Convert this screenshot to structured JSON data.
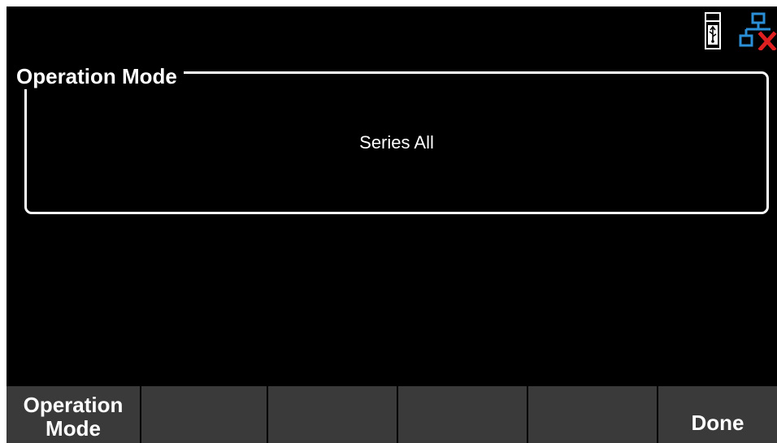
{
  "status_icons": {
    "usb": "usb-icon",
    "network": "network-disconnected-icon"
  },
  "operation_mode": {
    "title": "Operation Mode",
    "value": "Series All"
  },
  "softkeys": [
    {
      "label": "Operation\nMode"
    },
    {
      "label": ""
    },
    {
      "label": ""
    },
    {
      "label": ""
    },
    {
      "label": ""
    },
    {
      "label": "Done"
    }
  ],
  "colors": {
    "background": "#000000",
    "softkey": "#3a3a3a",
    "text": "#ffffff",
    "network_icon": "#2a8fd6",
    "network_x": "#e02020"
  }
}
